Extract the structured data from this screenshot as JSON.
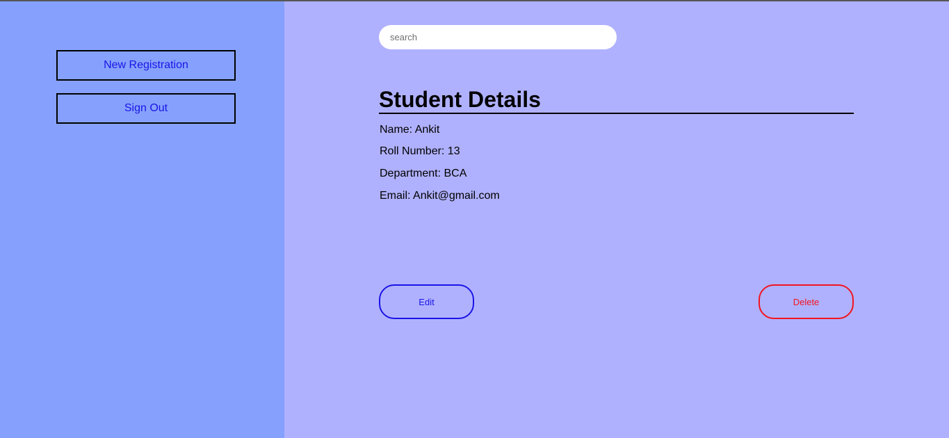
{
  "sidebar": {
    "buttons": [
      {
        "label": "New Registration"
      },
      {
        "label": "Sign Out"
      }
    ]
  },
  "search": {
    "placeholder": "search",
    "value": ""
  },
  "details": {
    "title": "Student Details",
    "name": "Name: Ankit",
    "roll": "Roll Number: 13",
    "department": "Department: BCA",
    "email": "Email: Ankit@gmail.com"
  },
  "actions": {
    "edit_label": "Edit",
    "delete_label": "Delete"
  },
  "colors": {
    "sidebar_bg": "#86a1fd",
    "main_bg": "#b0b1fe",
    "link_blue": "#1a14e6",
    "danger_red": "#f2141e"
  }
}
